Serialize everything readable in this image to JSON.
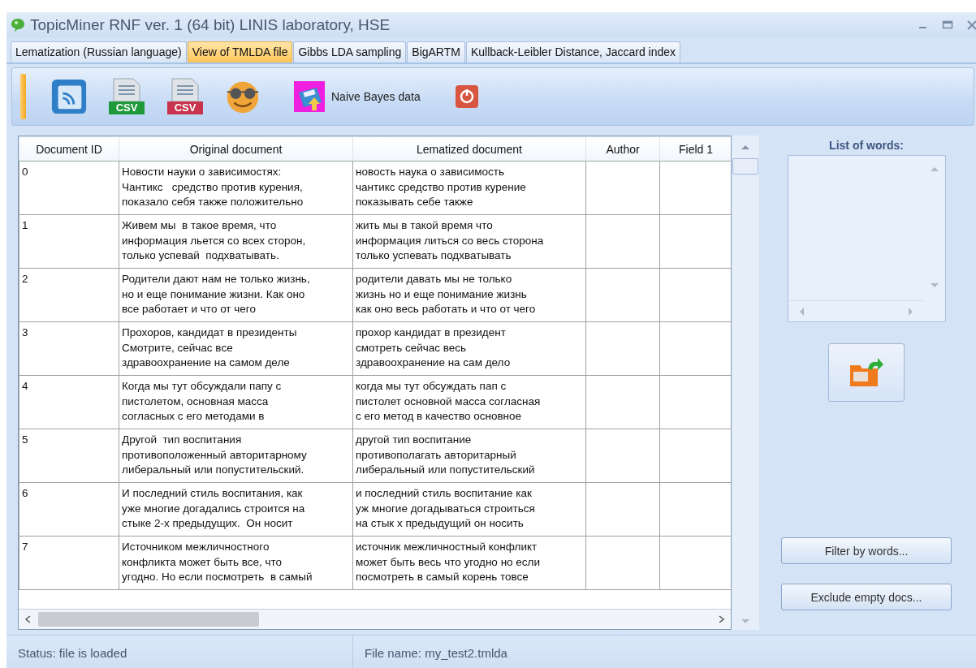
{
  "window": {
    "title": "TopicMiner RNF ver. 1 (64 bit) LINIS laboratory, HSE"
  },
  "tabs": [
    {
      "label": "Lematization (Russian language)",
      "selected": false
    },
    {
      "label": "View of TMLDA file",
      "selected": true
    },
    {
      "label": "Gibbs LDA sampling",
      "selected": false
    },
    {
      "label": "BigARTM",
      "selected": false
    },
    {
      "label": "Kullback-Leibler Distance, Jaccard index",
      "selected": false
    }
  ],
  "toolbar": [
    {
      "kind": "feed"
    },
    {
      "kind": "csv",
      "badge": "CSV",
      "color": "#1e9a3a"
    },
    {
      "kind": "csv",
      "badge": "CSV",
      "color": "#c8334d"
    },
    {
      "kind": "glasses"
    },
    {
      "kind": "floppy",
      "label": "Naive Bayes data"
    },
    {
      "kind": "power"
    }
  ],
  "table": {
    "columns": [
      "Document ID",
      "Original document",
      "Lematized document",
      "Author",
      "Field 1"
    ],
    "rows": [
      {
        "id": "0",
        "original": [
          "Новости науки о зависимостях:",
          "Чантикс   средство против курения,",
          "показало себя также положительно"
        ],
        "lematized": [
          "новость наука о зависимость",
          "чантикс средство против курение",
          "показывать себе также"
        ]
      },
      {
        "id": "1",
        "original": [
          "Живем мы  в такое время, что",
          "информация льется со всех сторон,",
          "только успевай  подхватывать."
        ],
        "lematized": [
          "жить мы в такой время что",
          "информация литься со весь сторона",
          "только успевать подхватывать"
        ]
      },
      {
        "id": "2",
        "original": [
          "Родители дают нам не только жизнь,",
          "но и еще понимание жизни. Как оно",
          "все работает и что от чего"
        ],
        "lematized": [
          "родители давать мы не только",
          "жизнь но и еще понимание жизнь",
          "как оно весь работать и что от чего"
        ]
      },
      {
        "id": "3",
        "original": [
          "Прохоров, кандидат в президенты",
          "Смотрите, сейчас все",
          "здравоохранение на самом деле"
        ],
        "lematized": [
          "прохор кандидат в президент",
          "смотреть сейчас весь",
          "здравоохранение на сам дело"
        ]
      },
      {
        "id": "4",
        "original": [
          "Когда мы тут обсуждали папу с",
          "пистолетом, основная масса",
          "согласных с его методами в"
        ],
        "lematized": [
          "когда мы тут обсуждать пап с",
          "пистолет основной масса согласная",
          "с его метод в качество основное"
        ]
      },
      {
        "id": "5",
        "original": [
          "Другой  тип воспитания",
          "противоположенный авторитарному",
          "либеральный или попустительский."
        ],
        "lematized": [
          "другой тип воспитание",
          "противополагать авторитарный",
          "либеральный или попустительский"
        ]
      },
      {
        "id": "6",
        "original": [
          "И последний стиль воспитания, как",
          "уже многие догадались строится на",
          "стыке 2-х предыдущих.  Он носит"
        ],
        "lematized": [
          "и последний стиль воспитание как",
          "уж многие догадываться строиться",
          "на стык х предыдущий он носить"
        ]
      },
      {
        "id": "7",
        "original": [
          "Источником межличностного",
          "конфликта может быть все, что",
          "угодно. Но если посмотреть  в самый"
        ],
        "lematized": [
          "источник межличностный конфликт",
          "может быть весь что угодно но если",
          "посмотреть в самый корень товсе"
        ]
      }
    ]
  },
  "side_panel": {
    "list_label": "List of words:",
    "buttons": [
      "Filter by words...",
      "Exclude empty docs..."
    ]
  },
  "status_bar": [
    "Status: file is loaded",
    "File name: my_test2.tmlda"
  ]
}
